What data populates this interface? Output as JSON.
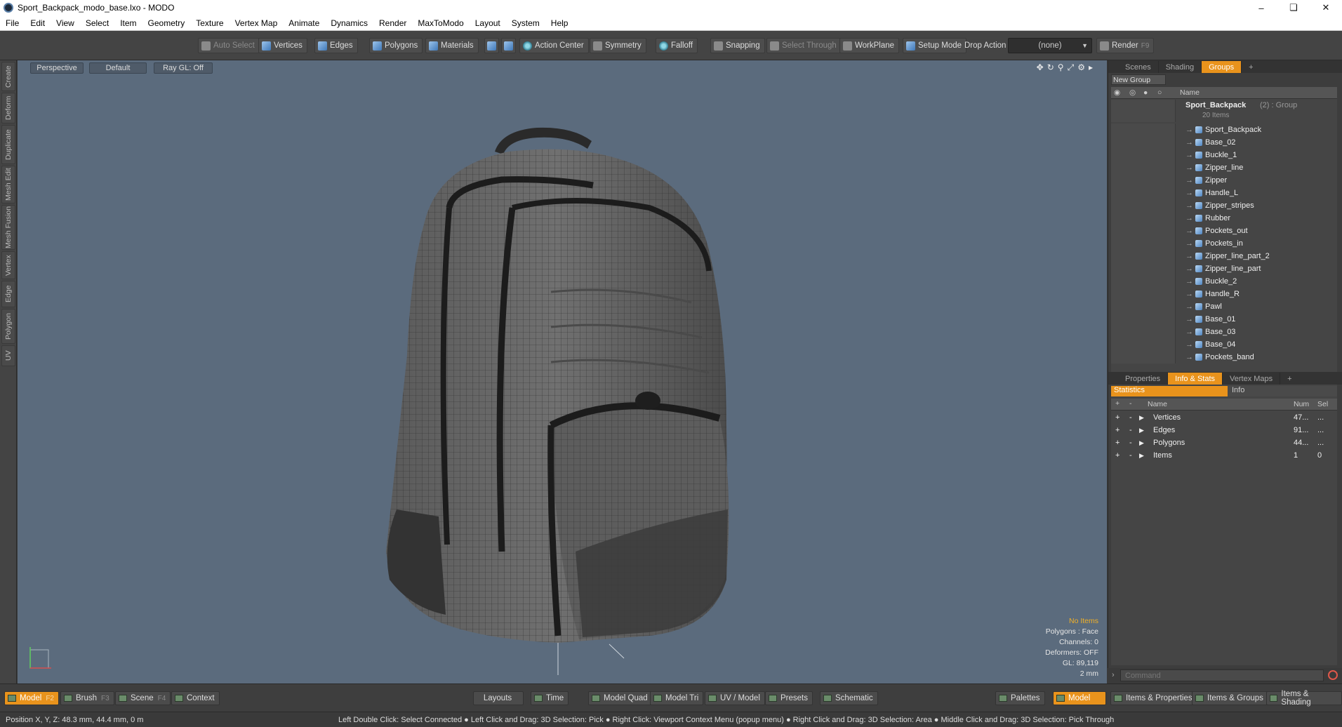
{
  "window": {
    "title": "Sport_Backpack_modo_base.lxo - MODO",
    "min": "–",
    "max": "❏",
    "close": "✕"
  },
  "menu": [
    "File",
    "Edit",
    "View",
    "Select",
    "Item",
    "Geometry",
    "Texture",
    "Vertex Map",
    "Animate",
    "Dynamics",
    "Render",
    "MaxToModo",
    "Layout",
    "System",
    "Help"
  ],
  "toolbar": {
    "auto_select": "Auto Select",
    "vertices": "Vertices",
    "edges": "Edges",
    "polygons": "Polygons",
    "materials": "Materials",
    "action_center": "Action Center",
    "symmetry": "Symmetry",
    "falloff": "Falloff",
    "snapping": "Snapping",
    "select_through": "Select Through",
    "workplane": "WorkPlane",
    "setup_mode": "Setup Mode",
    "drop_action": "Drop Action",
    "drop_value": "(none)",
    "render": "Render",
    "render_key": "F9"
  },
  "left_tabs": [
    "Create",
    "Deform",
    "Duplicate",
    "Mesh Edit",
    "Mesh Fusion",
    "Vertex",
    "Edge",
    "Polygon",
    "UV"
  ],
  "viewport": {
    "view": "Perspective",
    "shading": "Default",
    "raygl": "Ray GL: Off",
    "overlay": {
      "no_items": "No Items",
      "polygons": "Polygons : Face",
      "channels": "Channels: 0",
      "deformers": "Deformers: OFF",
      "gl": "GL: 89,119",
      "scale": "2 mm"
    }
  },
  "scene_panel": {
    "tabs": [
      "Scenes",
      "Shading",
      "Groups"
    ],
    "active_tab": "Groups",
    "new_group": "New Group",
    "name_col": "Name",
    "group_name": "Sport_Backpack",
    "group_suffix": "(2) : Group",
    "group_count": "20 Items",
    "items": [
      "Sport_Backpack",
      "Base_02",
      "Buckle_1",
      "Zipper_line",
      "Zipper",
      "Handle_L",
      "Zipper_stripes",
      "Rubber",
      "Pockets_out",
      "Pockets_in",
      "Zipper_line_part_2",
      "Zipper_line_part",
      "Buckle_2",
      "Handle_R",
      "Pawl",
      "Base_01",
      "Base_03",
      "Base_04",
      "Pockets_band"
    ]
  },
  "props_panel": {
    "tabs": [
      "Properties",
      "Info & Stats",
      "Vertex Maps"
    ],
    "active_tab": "Info & Stats",
    "subtabs": [
      "Statistics",
      "Info"
    ],
    "cols": {
      "name": "Name",
      "num": "Num",
      "sel": "Sel"
    },
    "rows": [
      {
        "name": "Vertices",
        "num": "47...",
        "sel": "..."
      },
      {
        "name": "Edges",
        "num": "91...",
        "sel": "..."
      },
      {
        "name": "Polygons",
        "num": "44...",
        "sel": "..."
      },
      {
        "name": "Items",
        "num": "1",
        "sel": "0"
      }
    ]
  },
  "command": {
    "placeholder": "Command"
  },
  "bottom": {
    "model": "Model",
    "model_key": "F2",
    "brush": "Brush",
    "brush_key": "F3",
    "scene": "Scene",
    "scene_key": "F4",
    "context": "Context",
    "layouts": "Layouts",
    "time": "Time",
    "model_quad": "Model Quad",
    "model_tri": "Model Tri",
    "uv_model": "UV / Model",
    "presets": "Presets",
    "schematic": "Schematic",
    "palettes": "Palettes",
    "model_right": "Model",
    "items_props": "Items & Properties",
    "items_groups": "Items & Groups",
    "items_shading": "Items & Shading"
  },
  "status": {
    "position": "Position X, Y, Z:   48.3 mm, 44.4 mm, 0 m",
    "hint": "Left Double Click: Select Connected ● Left Click and Drag: 3D Selection: Pick ● Right Click: Viewport Context Menu (popup menu) ● Right Click and Drag: 3D Selection: Area ● Middle Click and Drag: 3D Selection: Pick Through"
  }
}
